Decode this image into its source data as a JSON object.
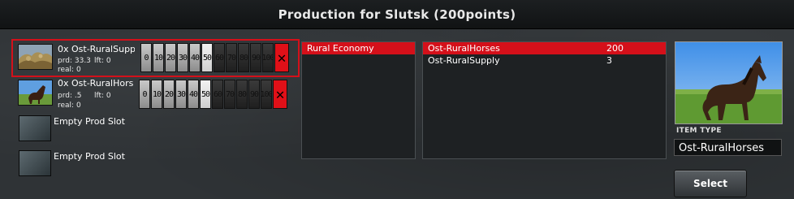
{
  "window": {
    "title": "Production for Slutsk (200points)"
  },
  "slots": [
    {
      "name": "0x Ost-RuralSupp",
      "prd": "prd: 33.3",
      "lft": "lft: 0",
      "real": "real: 0",
      "thumb_icon": "rocks-supply-icon",
      "selected": true
    },
    {
      "name": "0x Ost-RuralHors",
      "prd": "prd: .5",
      "lft": "lft: 0",
      "real": "real: 0",
      "thumb_icon": "horse-icon",
      "selected": false
    }
  ],
  "quantity_buttons": [
    "0",
    "10",
    "20",
    "30",
    "40",
    "50",
    "60",
    "70",
    "80",
    "90",
    "100"
  ],
  "delete_symbol": "✕",
  "empty_slots": [
    "Empty Prod Slot",
    "Empty Prod Slot"
  ],
  "categories": [
    {
      "label": "Rural Economy",
      "selected": true
    }
  ],
  "items": [
    {
      "name": "Ost-RuralHorses",
      "value": "200",
      "selected": true
    },
    {
      "name": "Ost-RuralSupply",
      "value": "3",
      "selected": false
    }
  ],
  "details": {
    "item_type_label": "ITEM TYPE",
    "item_type_value": "Ost-RuralHorses",
    "select_label": "Select"
  },
  "colors": {
    "selection": "#d4101a",
    "panel_bg": "#1e2123",
    "delete": "#e01018"
  }
}
